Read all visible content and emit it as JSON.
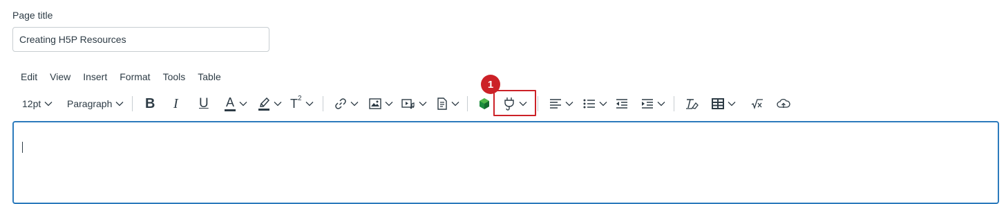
{
  "page_title": {
    "label": "Page title",
    "value": "Creating H5P Resources"
  },
  "menubar": {
    "items": [
      "Edit",
      "View",
      "Insert",
      "Format",
      "Tools",
      "Table"
    ]
  },
  "toolbar": {
    "font_size": "12pt",
    "block_format": "Paragraph",
    "bold": "B",
    "italic": "I",
    "underline": "U",
    "text_color_letter": "A",
    "text_color_accent": "#2d3b45",
    "superscript_base": "T",
    "superscript_exp": "2",
    "h5p_logo_color": "#1b8c3e"
  },
  "annotation": {
    "badge_number": "1",
    "highlight_color": "#cc2127"
  },
  "editor": {
    "focus_border_color": "#2b7abc"
  }
}
